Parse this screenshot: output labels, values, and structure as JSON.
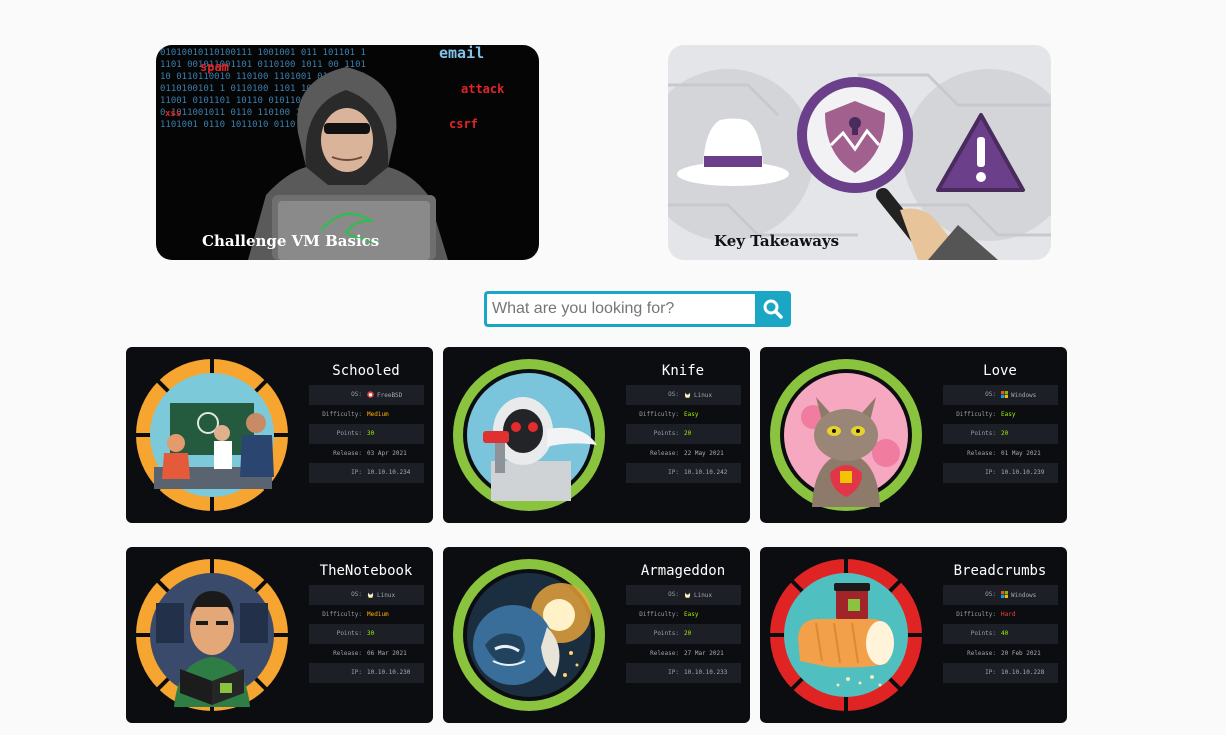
{
  "banners": [
    {
      "title": "Challenge VM Basics"
    },
    {
      "title": "Key Takeaways"
    }
  ],
  "banner_art_text": [
    "email",
    "spam",
    "attack",
    "csrf",
    "xss"
  ],
  "search": {
    "placeholder": "What are you looking for?"
  },
  "labels": {
    "os": "OS:",
    "difficulty": "Difficulty:",
    "points": "Points:",
    "release": "Release:",
    "ip": "IP:"
  },
  "colors": {
    "accent": "#1aa6c4",
    "card_bg": "#0c0d10",
    "easy": "#9fef00",
    "medium": "#ffaf00",
    "hard": "#ff3e3e"
  },
  "machines": [
    {
      "name": "Schooled",
      "os": "FreeBSD",
      "os_icon": "freebsd-icon",
      "difficulty": "Medium",
      "points": "30",
      "release": "03 Apr 2021",
      "ip": "10.10.10.234"
    },
    {
      "name": "Knife",
      "os": "Linux",
      "os_icon": "linux-icon",
      "difficulty": "Easy",
      "points": "20",
      "release": "22 May 2021",
      "ip": "10.10.10.242"
    },
    {
      "name": "Love",
      "os": "Windows",
      "os_icon": "windows-icon",
      "difficulty": "Easy",
      "points": "20",
      "release": "01 May 2021",
      "ip": "10.10.10.239"
    },
    {
      "name": "TheNotebook",
      "os": "Linux",
      "os_icon": "linux-icon",
      "difficulty": "Medium",
      "points": "30",
      "release": "06 Mar 2021",
      "ip": "10.10.10.230"
    },
    {
      "name": "Armageddon",
      "os": "Linux",
      "os_icon": "linux-icon",
      "difficulty": "Easy",
      "points": "20",
      "release": "27 Mar 2021",
      "ip": "10.10.10.233"
    },
    {
      "name": "Breadcrumbs",
      "os": "Windows",
      "os_icon": "windows-icon",
      "difficulty": "Hard",
      "points": "40",
      "release": "20 Feb 2021",
      "ip": "10.10.10.228"
    }
  ]
}
